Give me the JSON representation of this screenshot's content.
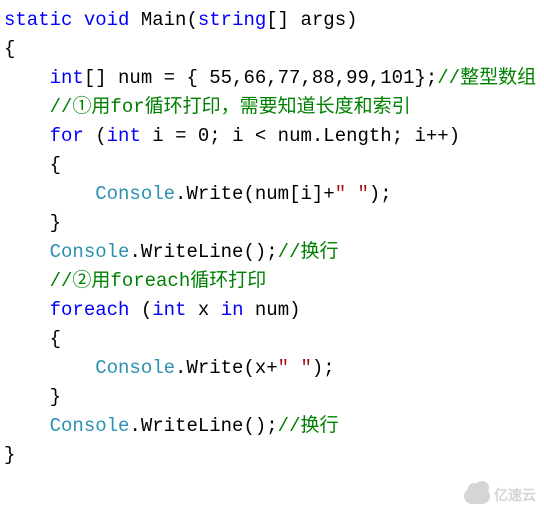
{
  "code": {
    "lines": [
      {
        "indent": 0,
        "tokens": [
          {
            "cls": "k",
            "text": "static"
          },
          {
            "cls": "t",
            "text": " "
          },
          {
            "cls": "k",
            "text": "void"
          },
          {
            "cls": "t",
            "text": " Main("
          },
          {
            "cls": "k",
            "text": "string"
          },
          {
            "cls": "t",
            "text": "[] args)"
          }
        ]
      },
      {
        "indent": 0,
        "tokens": [
          {
            "cls": "t",
            "text": "{"
          }
        ]
      },
      {
        "indent": 1,
        "tokens": [
          {
            "cls": "k",
            "text": "int"
          },
          {
            "cls": "t",
            "text": "[] num = { 55,66,77,88,99,101};"
          },
          {
            "cls": "c",
            "text": "//整型数组"
          }
        ]
      },
      {
        "indent": 1,
        "tokens": [
          {
            "cls": "c",
            "text": "//①用for循环打印，需要知道长度和索引"
          }
        ]
      },
      {
        "indent": 1,
        "tokens": [
          {
            "cls": "k",
            "text": "for"
          },
          {
            "cls": "t",
            "text": " ("
          },
          {
            "cls": "k",
            "text": "int"
          },
          {
            "cls": "t",
            "text": " i = 0; i < num.Length; i++)"
          }
        ]
      },
      {
        "indent": 1,
        "tokens": [
          {
            "cls": "t",
            "text": "{"
          }
        ]
      },
      {
        "indent": 2,
        "tokens": [
          {
            "cls": "cl",
            "text": "Console"
          },
          {
            "cls": "t",
            "text": ".Write(num[i]+"
          },
          {
            "cls": "s",
            "text": "\" \""
          },
          {
            "cls": "t",
            "text": ");"
          }
        ]
      },
      {
        "indent": 1,
        "tokens": [
          {
            "cls": "t",
            "text": "}"
          }
        ]
      },
      {
        "indent": 1,
        "tokens": [
          {
            "cls": "cl",
            "text": "Console"
          },
          {
            "cls": "t",
            "text": ".WriteLine();"
          },
          {
            "cls": "c",
            "text": "//换行"
          }
        ]
      },
      {
        "indent": 1,
        "tokens": [
          {
            "cls": "c",
            "text": "//②用foreach循环打印"
          }
        ]
      },
      {
        "indent": 1,
        "tokens": [
          {
            "cls": "k",
            "text": "foreach"
          },
          {
            "cls": "t",
            "text": " ("
          },
          {
            "cls": "k",
            "text": "int"
          },
          {
            "cls": "t",
            "text": " x "
          },
          {
            "cls": "k",
            "text": "in"
          },
          {
            "cls": "t",
            "text": " num)"
          }
        ]
      },
      {
        "indent": 1,
        "tokens": [
          {
            "cls": "t",
            "text": "{"
          }
        ]
      },
      {
        "indent": 2,
        "tokens": [
          {
            "cls": "cl",
            "text": "Console"
          },
          {
            "cls": "t",
            "text": ".Write(x+"
          },
          {
            "cls": "s",
            "text": "\" \""
          },
          {
            "cls": "t",
            "text": ");"
          }
        ]
      },
      {
        "indent": 1,
        "tokens": [
          {
            "cls": "t",
            "text": "}"
          }
        ]
      },
      {
        "indent": 1,
        "tokens": [
          {
            "cls": "cl",
            "text": "Console"
          },
          {
            "cls": "t",
            "text": ".WriteLine();"
          },
          {
            "cls": "c",
            "text": "//换行"
          }
        ]
      },
      {
        "indent": 0,
        "tokens": [
          {
            "cls": "t",
            "text": "}"
          }
        ]
      }
    ]
  },
  "watermark": {
    "text": "亿速云"
  }
}
